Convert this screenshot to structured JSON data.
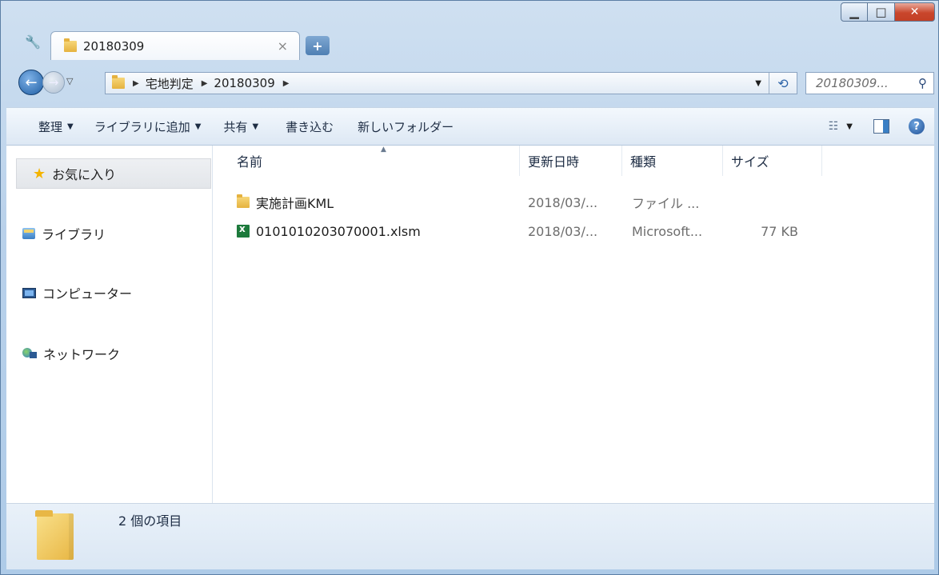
{
  "window": {
    "controls": {
      "minimize": "▁",
      "maximize": "□",
      "close": "✕"
    }
  },
  "tab": {
    "title": "20180309",
    "close_glyph": "×",
    "new_tab_glyph": "+"
  },
  "address": {
    "crumbs": [
      "宅地判定",
      "20180309"
    ],
    "search_placeholder": "20180309..."
  },
  "toolbar": {
    "organize": "整理",
    "add_to_library": "ライブラリに追加",
    "share": "共有",
    "burn": "書き込む",
    "new_folder": "新しいフォルダー"
  },
  "sidebar": {
    "items": [
      {
        "label": "お気に入り",
        "icon": "star-icon"
      },
      {
        "label": "ライブラリ",
        "icon": "library-icon"
      },
      {
        "label": "コンピューター",
        "icon": "computer-icon"
      },
      {
        "label": "ネットワーク",
        "icon": "network-icon"
      }
    ]
  },
  "columns": {
    "name": "名前",
    "modified": "更新日時",
    "type": "種類",
    "size": "サイズ"
  },
  "files": [
    {
      "name": "実施計画KML",
      "modified": "2018/03/...",
      "type": "ファイル ...",
      "size": "",
      "icon": "folder-icon"
    },
    {
      "name": "0101010203070001.xlsm",
      "modified": "2018/03/...",
      "type": "Microsoft...",
      "size": "77 KB",
      "icon": "excel-file-icon"
    }
  ],
  "status": {
    "item_count": "2 個の項目"
  },
  "colors": {
    "accent": "#2b62a7",
    "star": "#f4b400",
    "close": "#c9462c"
  }
}
